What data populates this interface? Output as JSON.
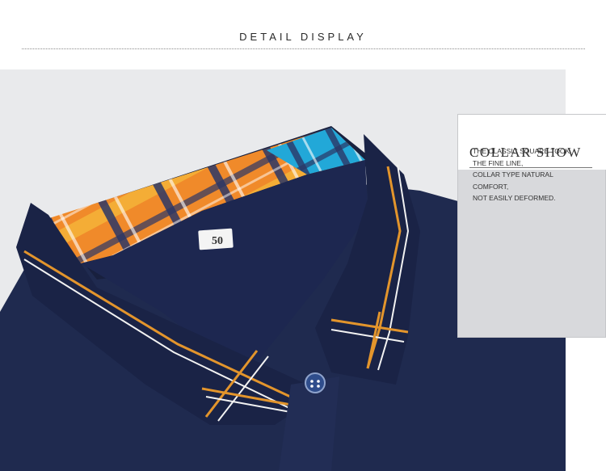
{
  "header": {
    "title": "DETAIL DISPLAY"
  },
  "product_photo": {
    "size_tag": "50",
    "colors": {
      "navy": "#1f2a4f",
      "collar_band": "#1a2346",
      "stripe_orange": "#e3952c",
      "stripe_white": "#f2f2f2",
      "plaid_orange": "#f08a2a",
      "plaid_blue": "#22a8d8",
      "background": "#e9eaec"
    },
    "icons": [
      "button-icon"
    ]
  },
  "side_panel": {
    "title": "COLLAR SHOW",
    "lines": [
      "THE CLASSIC SQUARE TOOK",
      "THE FINE LINE,",
      "COLLAR TYPE NATURAL",
      "COMFORT,",
      "NOT EASILY DEFORMED."
    ]
  }
}
